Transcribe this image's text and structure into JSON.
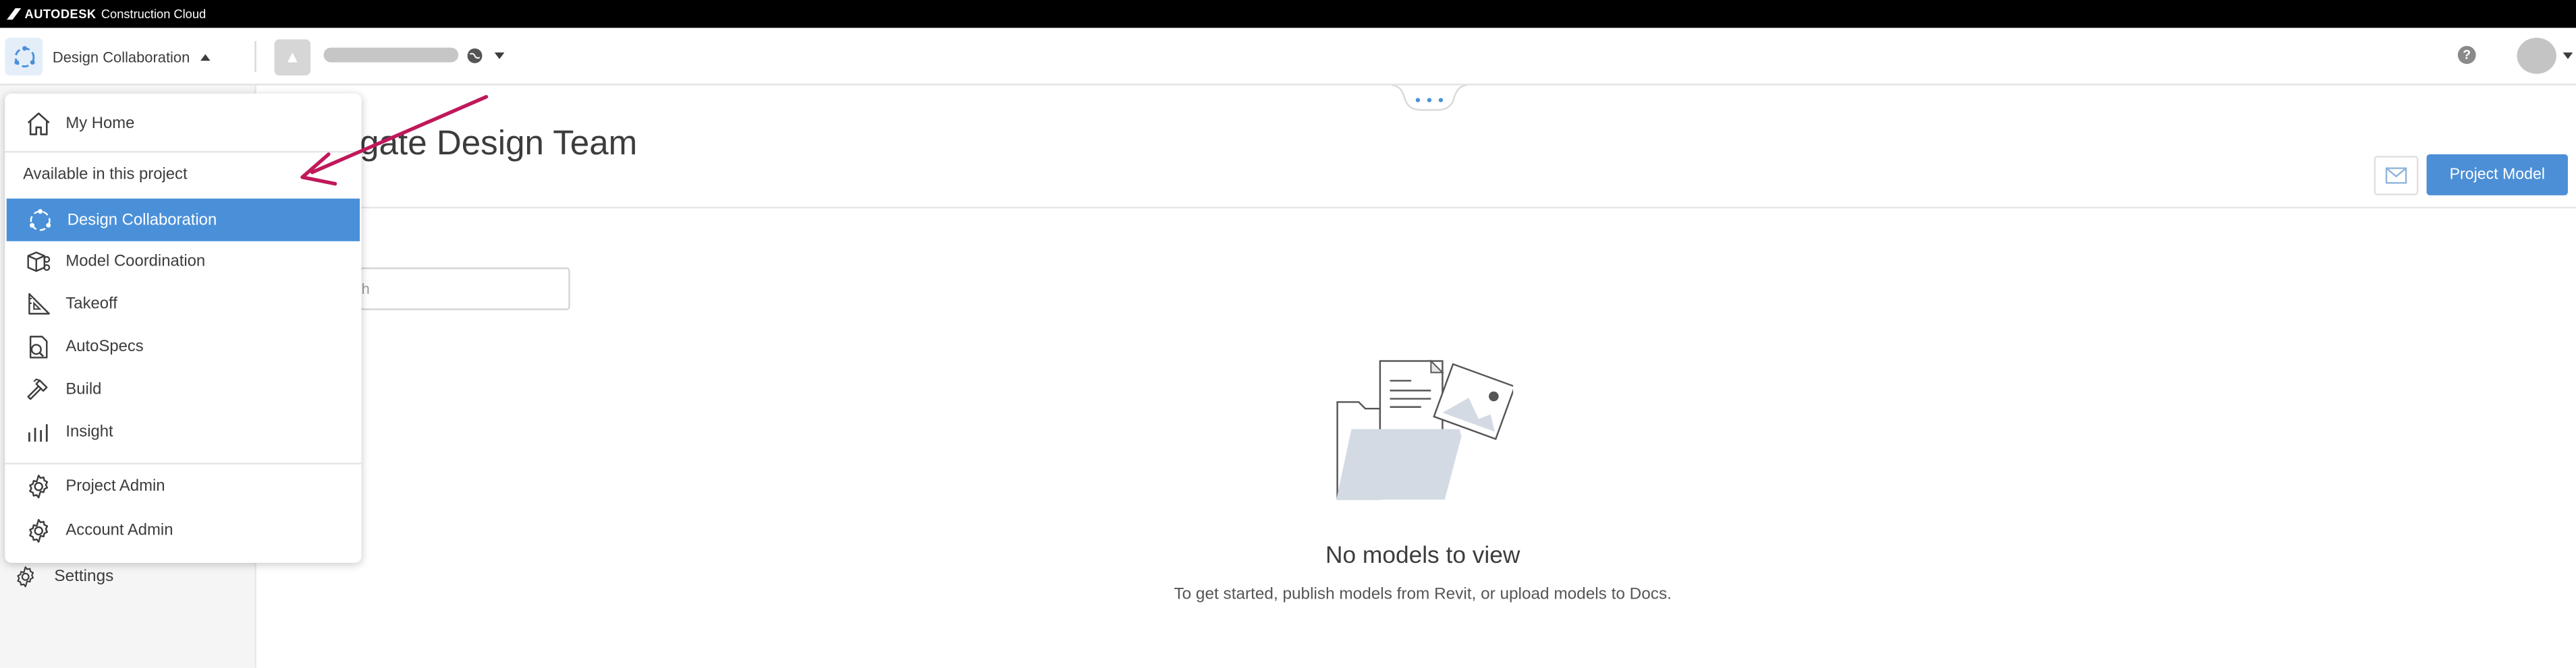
{
  "brand": {
    "company": "AUTODESK",
    "product": "Construction Cloud"
  },
  "top_nav": {
    "module_label": "Design Collaboration",
    "help_label": "?"
  },
  "module_menu": {
    "home_label": "My Home",
    "section_label": "Available in this project",
    "items": [
      {
        "label": "Design Collaboration",
        "icon": "design-collaboration-icon",
        "active": true
      },
      {
        "label": "Model Coordination",
        "icon": "model-coordination-icon",
        "active": false
      },
      {
        "label": "Takeoff",
        "icon": "takeoff-icon",
        "active": false
      },
      {
        "label": "AutoSpecs",
        "icon": "autospecs-icon",
        "active": false
      },
      {
        "label": "Build",
        "icon": "hammer-icon",
        "active": false
      },
      {
        "label": "Insight",
        "icon": "bar-chart-icon",
        "active": false
      }
    ],
    "admin_items": [
      {
        "label": "Project Admin",
        "icon": "gear-icon"
      },
      {
        "label": "Account Admin",
        "icon": "gear-icon"
      }
    ]
  },
  "sidebar": {
    "settings_label": "Settings"
  },
  "main": {
    "title": "gate Design Team",
    "primary_button": "Project Model",
    "search_partial": "h",
    "empty_title": "No models to view",
    "empty_subtitle": "To get started, publish models from Revit, or upload models to Docs."
  },
  "colors": {
    "accent": "#4a90d9",
    "annotation_arrow": "#c0185a"
  }
}
